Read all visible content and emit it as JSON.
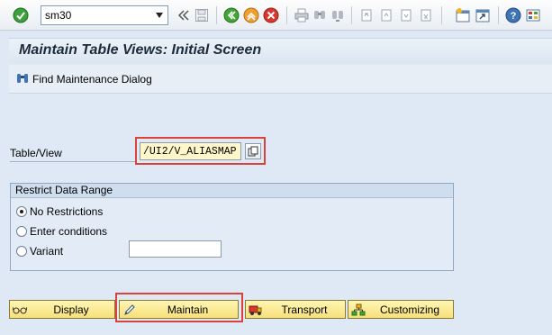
{
  "toolbar": {
    "command": "sm30",
    "icons": [
      "enter-icon",
      "chevron-left-double-icon",
      "save-icon",
      "back-icon",
      "exit-icon",
      "cancel-icon",
      "print-icon",
      "find-icon",
      "find-next-icon",
      "first-page-icon",
      "previous-page-icon",
      "next-page-icon",
      "last-page-icon",
      "create-session-icon",
      "shortcut-icon",
      "help-icon",
      "customize-layout-icon"
    ]
  },
  "title": "Maintain Table Views: Initial Screen",
  "app_toolbar": {
    "find_label": "Find Maintenance Dialog"
  },
  "table_view": {
    "label": "Table/View",
    "value": "/UI2/V_ALIASMAP"
  },
  "restrict": {
    "title": "Restrict Data Range",
    "options": [
      {
        "label": "No Restrictions",
        "checked": true
      },
      {
        "label": "Enter conditions",
        "checked": false
      },
      {
        "label": "Variant",
        "checked": false
      }
    ],
    "variant_value": ""
  },
  "buttons": {
    "display": "Display",
    "maintain": "Maintain",
    "transport": "Transport",
    "customizing": "Customizing"
  },
  "colors": {
    "highlight": "#d9433b",
    "button_fill": "#f7e07a",
    "background": "#dfe9f5"
  }
}
